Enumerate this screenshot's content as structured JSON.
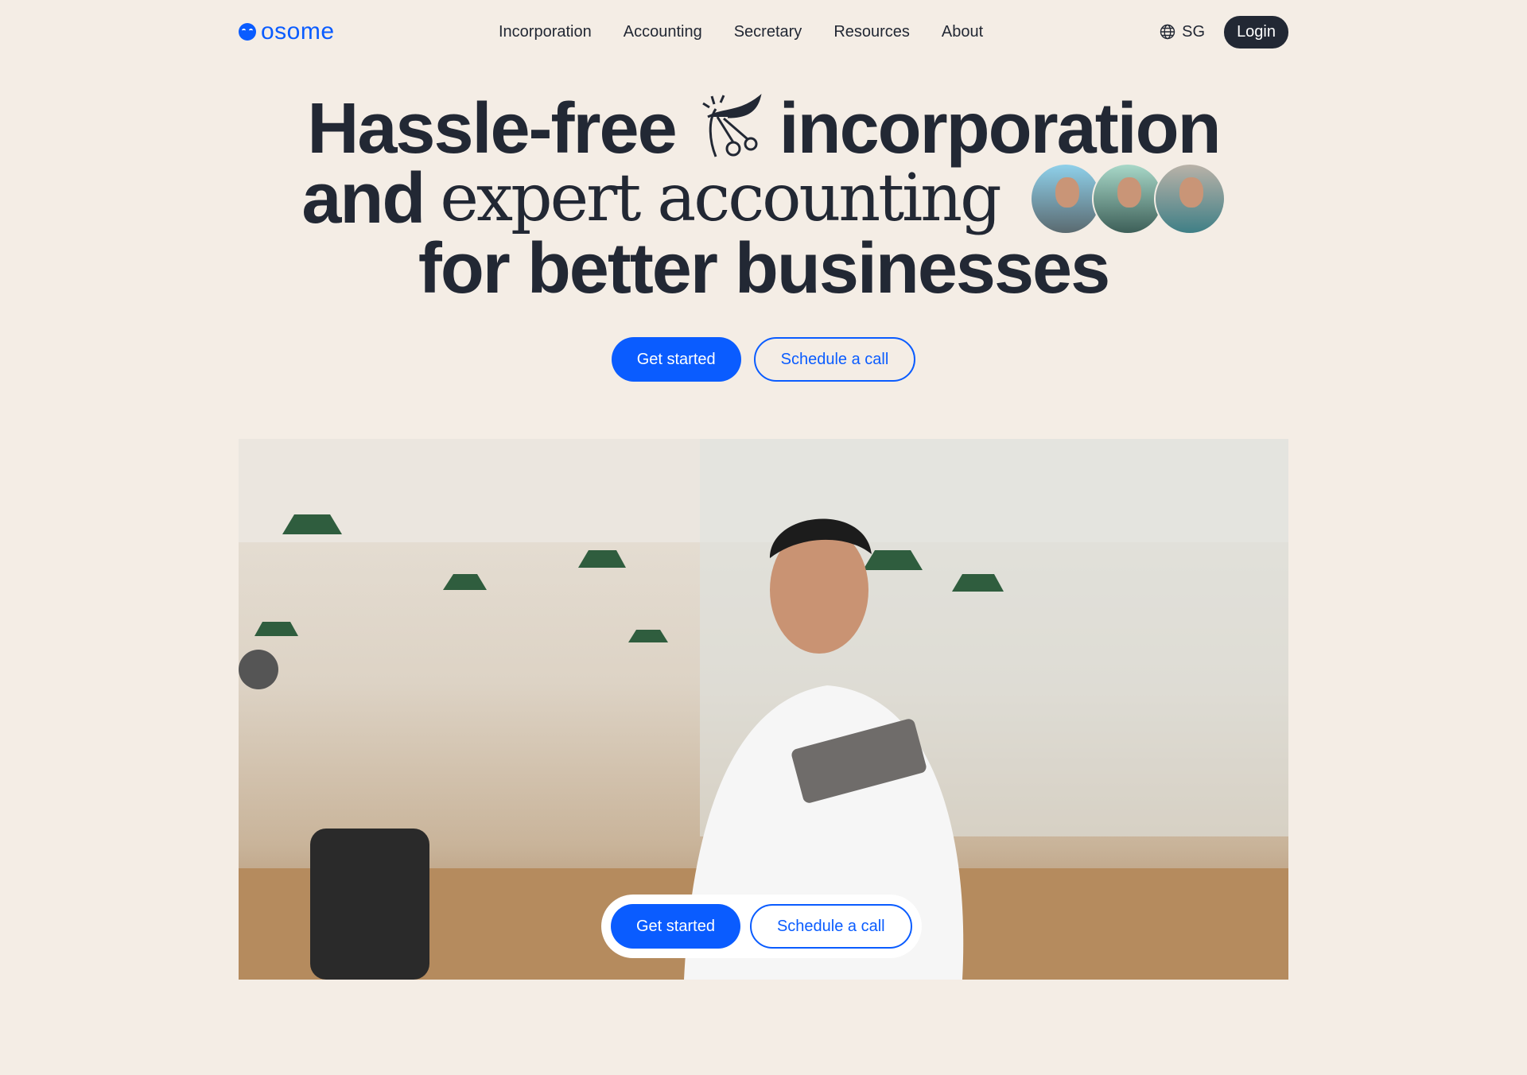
{
  "nav": {
    "logo": "osome",
    "items": [
      "Incorporation",
      "Accounting",
      "Secretary",
      "Resources",
      "About"
    ],
    "region": "SG",
    "login": "Login"
  },
  "hero": {
    "line1a": "Hassle-free",
    "line1b": "incorporation",
    "line2a": "and",
    "line2b": "expert accounting",
    "line3": "for better businesses"
  },
  "cta": {
    "primary": "Get started",
    "secondary": "Schedule a call"
  },
  "colors": {
    "brand": "#0a5cff",
    "dark": "#222834",
    "background": "#f4ede5"
  }
}
